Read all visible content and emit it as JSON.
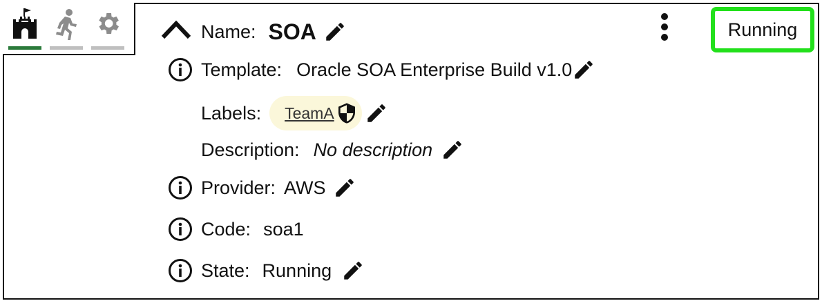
{
  "tabs": [
    {
      "name": "castle-icon",
      "underline": "#2a7a3a",
      "active": true
    },
    {
      "name": "running-person-icon",
      "underline": "#bfbfbf",
      "active": false
    },
    {
      "name": "gear-icon",
      "underline": "#bfbfbf",
      "active": false
    }
  ],
  "header": {
    "name_label": "Name:",
    "name_value": "SOA",
    "status": "Running",
    "status_color": "#22e01b"
  },
  "details": {
    "template_label": "Template:",
    "template_value": "Oracle SOA Enterprise Build v1.0",
    "labels_label": "Labels:",
    "label_chip": "TeamA",
    "description_label": "Description:",
    "description_value": "No description",
    "provider_label": "Provider:",
    "provider_value": "AWS",
    "code_label": "Code:",
    "code_value": "soa1",
    "state_label": "State:",
    "state_value": "Running"
  }
}
